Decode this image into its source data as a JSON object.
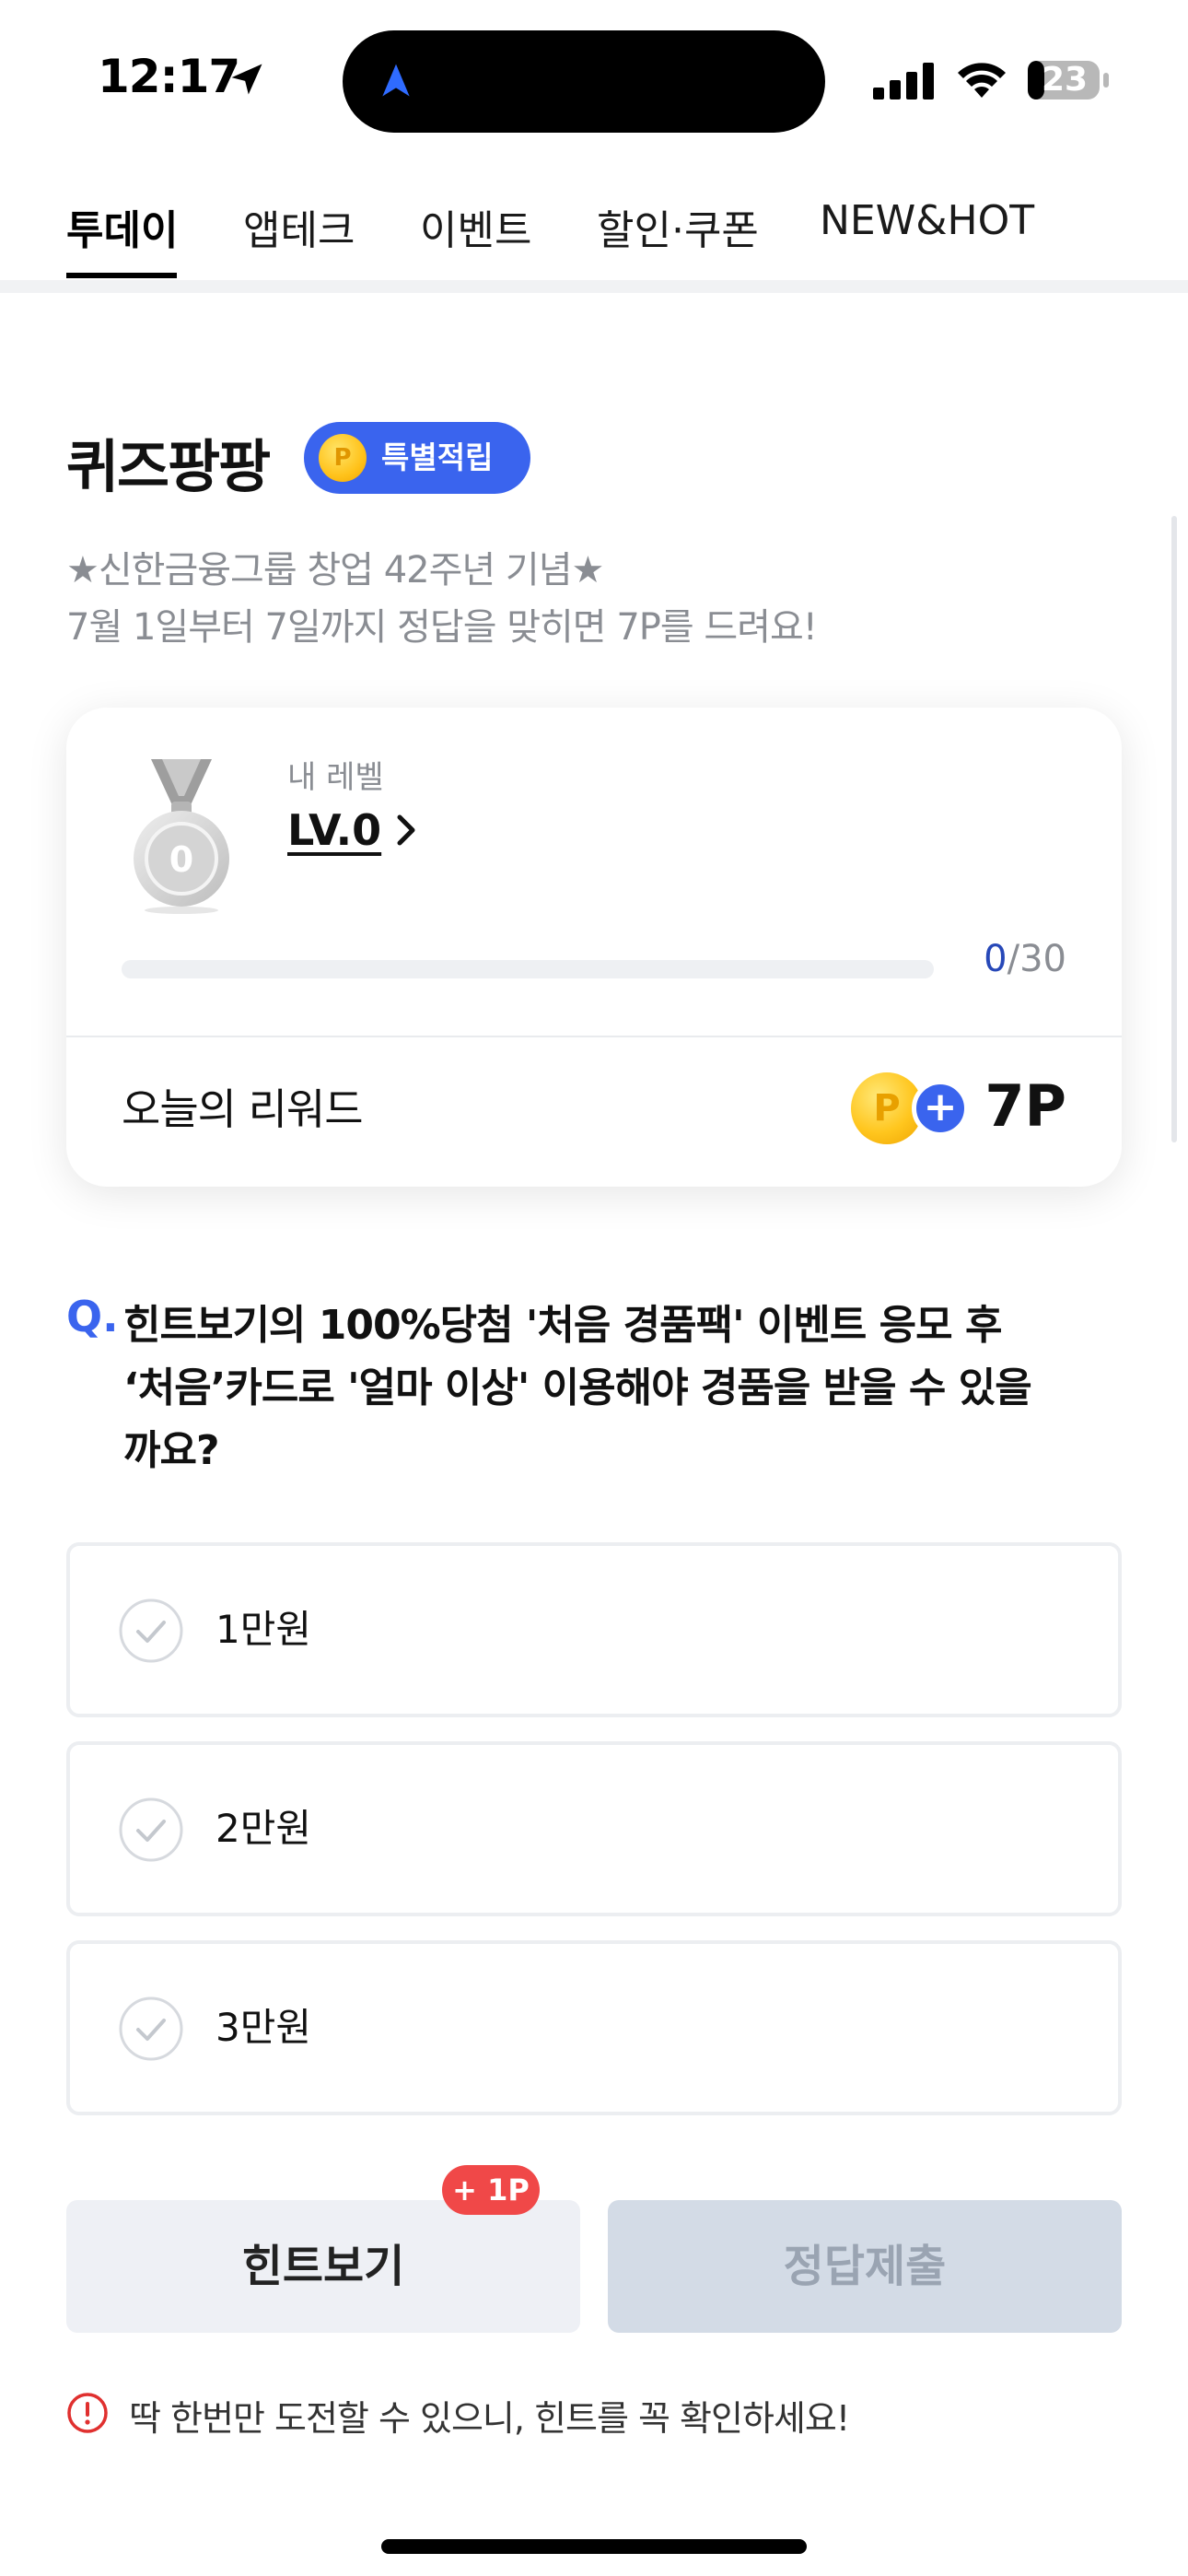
{
  "status_bar": {
    "time": "12:17",
    "battery": "23",
    "icons": [
      "location-arrow-icon",
      "navigation-icon",
      "signal-icon",
      "wifi-icon",
      "battery-icon"
    ]
  },
  "tabs": [
    {
      "label": "투데이",
      "active": true
    },
    {
      "label": "앱테크",
      "active": false
    },
    {
      "label": "이벤트",
      "active": false
    },
    {
      "label": "할인·쿠폰",
      "active": false
    },
    {
      "label": "NEW&HOT",
      "active": false
    }
  ],
  "header": {
    "title": "퀴즈팡팡",
    "badge_coin": "P",
    "badge_label": "특별적립",
    "subtitle_line1": "★신한금융그룹 창업 42주년 기념★",
    "subtitle_line2": "7월 1일부터 7일까지 정답을 맞히면 7P를 드려요!"
  },
  "level_card": {
    "caption": "내 레벨",
    "level": "LV.0",
    "medal_number": "0",
    "progress_current": "0",
    "progress_total": "/30",
    "progress_fraction": 0,
    "reward_label": "오늘의 리워드",
    "reward_coin": "P",
    "reward_plus": "+",
    "reward_value": "7P"
  },
  "question": {
    "prefix": "Q.",
    "line1": "힌트보기의 100%당첨 '처음 경품팩' 이벤트 응모 후",
    "line2": "‘처음’카드로 '얼마 이상' 이용해야 경품을 받을 수 있을",
    "line3": "까요?"
  },
  "options": [
    {
      "label": "1만원",
      "selected": false
    },
    {
      "label": "2만원",
      "selected": false
    },
    {
      "label": "3만원",
      "selected": false
    }
  ],
  "buttons": {
    "hint_label": "힌트보기",
    "hint_badge": "+ 1P",
    "submit_label": "정답제출",
    "submit_enabled": false
  },
  "notice": {
    "text": "딱 한번만 도전할 수 있으니, 힌트를 꼭 확인하세요!"
  },
  "colors": {
    "accent": "#3a64ee",
    "progress": "#2748b8",
    "badge_red": "#f04848",
    "notice_red": "#e0302f"
  }
}
